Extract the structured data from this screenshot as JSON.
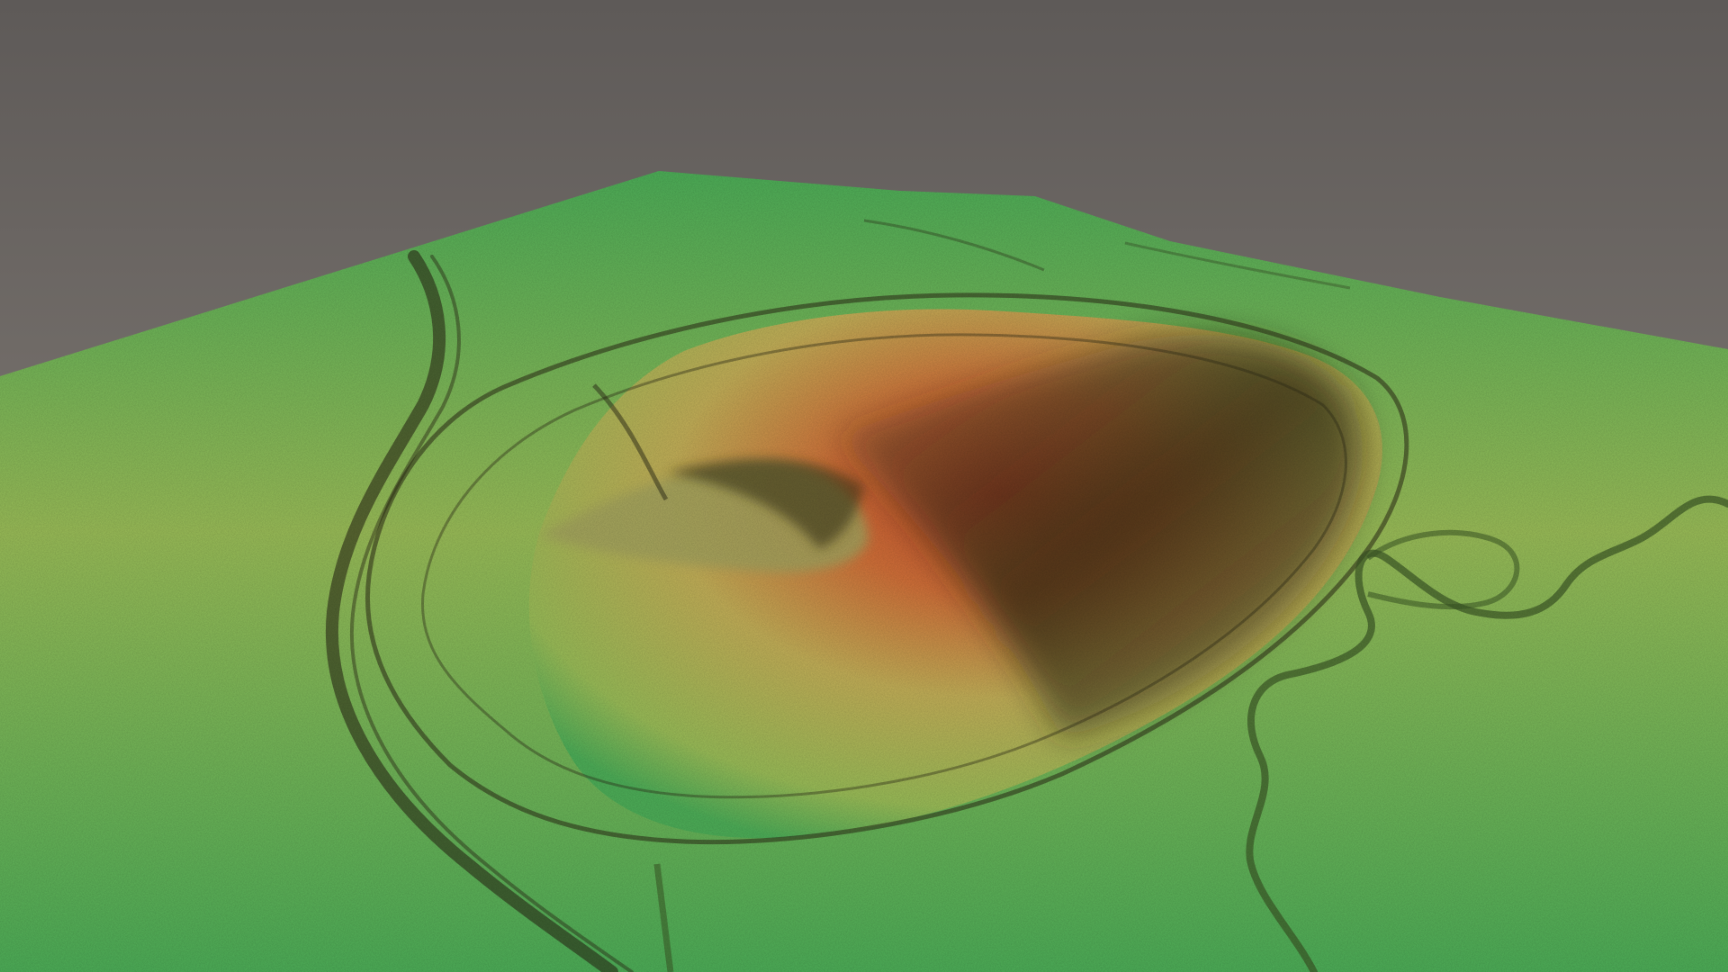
{
  "scene": {
    "subject": "3d-lidar-terrain-render",
    "colors": {
      "sky_top": "#5e5a58",
      "sky_bottom": "#8e8780",
      "low_elevation": "#4fb35a",
      "mid_elevation": "#9ec25a",
      "upper_elevation": "#c8b45a",
      "high_elevation": "#d7733a",
      "peak_elevation": "#c84a2a",
      "shadow": "#2c2a16",
      "channel": "#3d5a26"
    }
  }
}
